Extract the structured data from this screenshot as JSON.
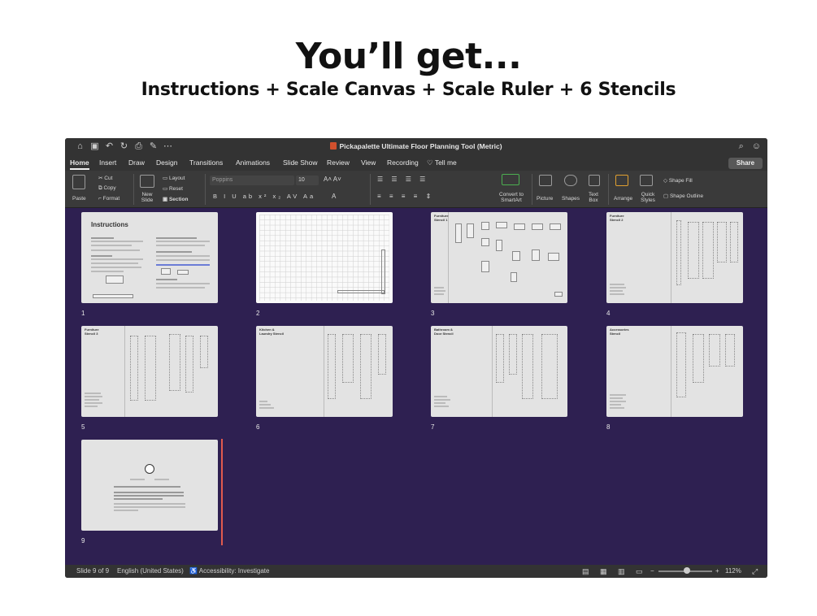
{
  "headline": "You’ll get...",
  "subheadline": "Instructions + Scale Canvas + Scale Ruler + 6 Stencils",
  "window": {
    "title": "Pickapalette Ultimate Floor Planning Tool (Metric)",
    "share_label": "Share"
  },
  "tabs": [
    "Home",
    "Insert",
    "Draw",
    "Design",
    "Transitions",
    "Animations",
    "Slide Show",
    "Review",
    "View",
    "Recording",
    "Tell me"
  ],
  "ribbon": {
    "paste": "Paste",
    "cut": "Cut",
    "copy": "Copy",
    "format": "Format",
    "new_slide": "New Slide",
    "layout": "Layout",
    "reset": "Reset",
    "section": "Section",
    "font": "Poppins",
    "font_size": "10",
    "convert": "Convert to SmartArt",
    "picture": "Picture",
    "shapes": "Shapes",
    "text_box": "Text Box",
    "arrange": "Arrange",
    "quick_styles": "Quick Styles",
    "shape_fill": "Shape Fill",
    "shape_outline": "Shape Outline"
  },
  "slides": [
    {
      "number": "1",
      "title": "Instructions"
    },
    {
      "number": "2",
      "title": ""
    },
    {
      "number": "3",
      "title": "Furniture Stencil 1"
    },
    {
      "number": "4",
      "title": "Furniture Stencil 2"
    },
    {
      "number": "5",
      "title": "Furniture Stencil 3"
    },
    {
      "number": "6",
      "title": "Kitchen & Laundry Stencil"
    },
    {
      "number": "7",
      "title": "Bathroom & Door Stencil"
    },
    {
      "number": "8",
      "title": "Accessories Stencil"
    },
    {
      "number": "9",
      "title": ""
    }
  ],
  "status": {
    "slide_info": "Slide 9 of 9",
    "language": "English (United States)",
    "accessibility": "Accessibility: Investigate",
    "zoom": "112%"
  }
}
